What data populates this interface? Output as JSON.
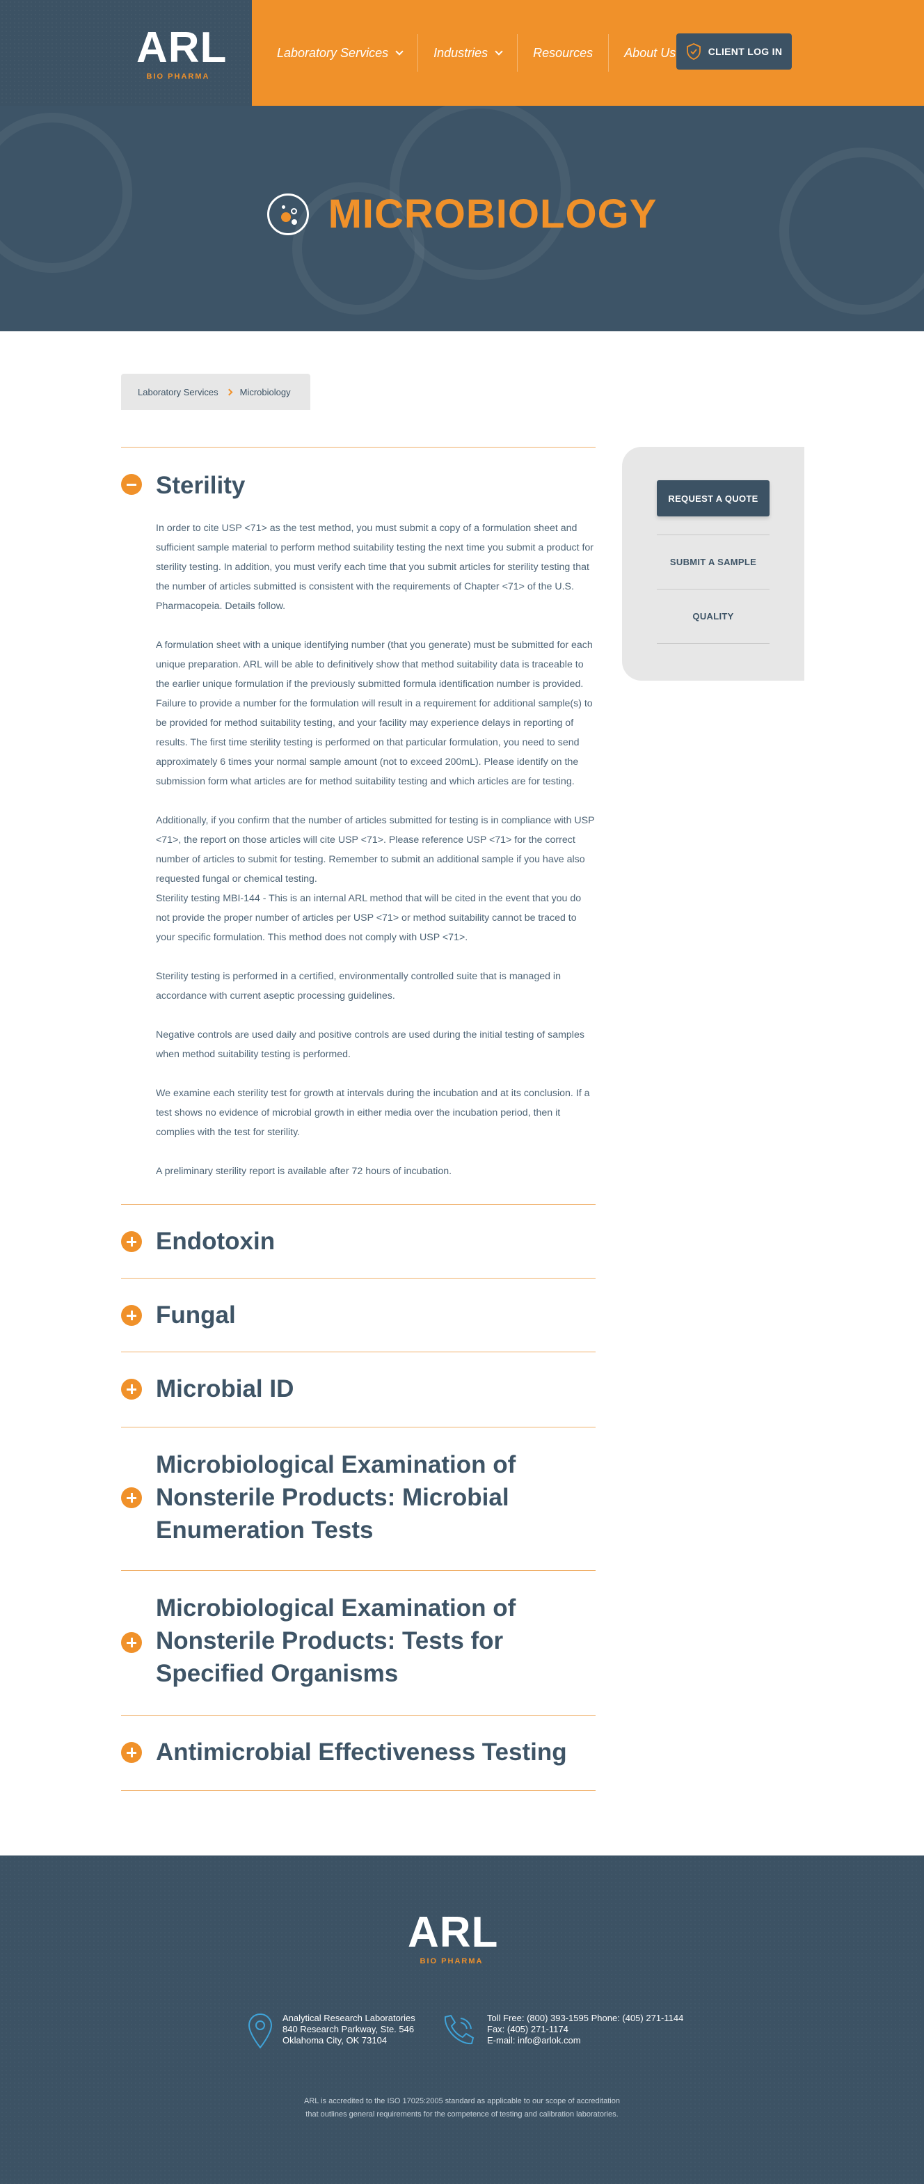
{
  "header": {
    "logo_text": "ARL",
    "logo_sub": "BIO PHARMA",
    "nav": [
      {
        "label": "Laboratory Services",
        "has_dropdown": true
      },
      {
        "label": "Industries",
        "has_dropdown": true
      },
      {
        "label": "Resources",
        "has_dropdown": false
      },
      {
        "label": "About Us",
        "has_dropdown": true
      }
    ],
    "client_login": "CLIENT LOG IN"
  },
  "hero": {
    "title": "MICROBIOLOGY"
  },
  "breadcrumb": {
    "parent": "Laboratory Services",
    "current": "Microbiology"
  },
  "accordion": {
    "sterility": {
      "title": "Sterility",
      "expanded": true,
      "paragraphs": [
        " In order to cite USP <71> as the test method, you must submit a copy of a formulation sheet and sufficient sample material to perform method suitability testing the next time you submit a product for sterility testing. In addition, you must verify each time that you submit articles for sterility testing that the number of articles submitted is consistent with the requirements of Chapter <71> of the U.S. Pharmacopeia. Details follow.",
        "A formulation sheet with a unique identifying number (that you generate) must be submitted for each unique preparation. ARL will be able to definitively show that method suitability data is traceable to the earlier unique formulation if the previously submitted formula identification number is provided. Failure to provide a number for the formulation will result in a requirement for additional sample(s) to be provided for method suitability testing, and your facility may experience delays in reporting of results. The first time sterility testing is performed on that particular formulation, you need to send approximately 6 times your normal sample amount (not to exceed 200mL). Please identify on the submission form what articles are for method suitability testing and which articles are for testing.",
        "Additionally, if you confirm that the number of articles submitted for testing is in compliance with USP <71>, the report on those articles will cite USP <71>. Please reference USP <71> for the correct number of articles to submit for testing. Remember to submit an additional sample if you have also requested fungal or chemical testing.",
        "Sterility testing MBI-144 - This is an internal ARL method that will be cited in the event that you do not provide the proper number of articles per USP <71> or method suitability cannot be traced to your specific formulation. This method does not comply with USP <71>.",
        "Sterility testing is performed in a certified, environmentally controlled suite that is managed in accordance with current aseptic processing guidelines.",
        "Negative controls are used daily and positive controls are used during the initial testing of samples when method suitability testing is performed.",
        "We examine each sterility test for growth at intervals during the incubation and at its conclusion. If a test shows no evidence of microbial growth in either media over the incubation period, then it complies with the test for sterility.",
        "A preliminary sterility report is available after 72 hours of incubation."
      ]
    },
    "endotoxin": {
      "title": "Endotoxin"
    },
    "fungal": {
      "title": "Fungal"
    },
    "microbial_id": {
      "title": "Microbial ID"
    },
    "enumeration": {
      "title": "Microbiological Examination of Nonsterile Products: Microbial Enumeration Tests"
    },
    "specified": {
      "title": "Microbiological Examination of Nonsterile Products: Tests for Specified Organisms"
    },
    "antimicrobial": {
      "title": "Antimicrobial Effectiveness Testing"
    }
  },
  "sidebar": {
    "request_quote": "REQUEST A QUOTE",
    "submit_sample": "SUBMIT A SAMPLE",
    "quality": "QUALITY"
  },
  "footer": {
    "logo_text": "ARL",
    "logo_sub": "BIO PHARMA",
    "address": {
      "line1": "Analytical Research Laboratories",
      "line2": "840 Research Parkway, Ste. 546",
      "line3": "Oklahoma City, OK 73104"
    },
    "phone": {
      "line1": "Toll Free: (800) 393-1595 Phone: (405) 271-1144",
      "line2": "Fax: (405) 271-1174",
      "line3": "E-mail: info@arlok.com"
    },
    "legal_1": "ARL is accredited to the ISO 17025:2005 standard as applicable to our scope of accreditation",
    "legal_2": "that outlines general requirements for the competence of testing and calibration laboratories."
  },
  "colors": {
    "orange": "#f0912a",
    "navy": "#3c5264",
    "light_gray": "#e7e7e7"
  }
}
